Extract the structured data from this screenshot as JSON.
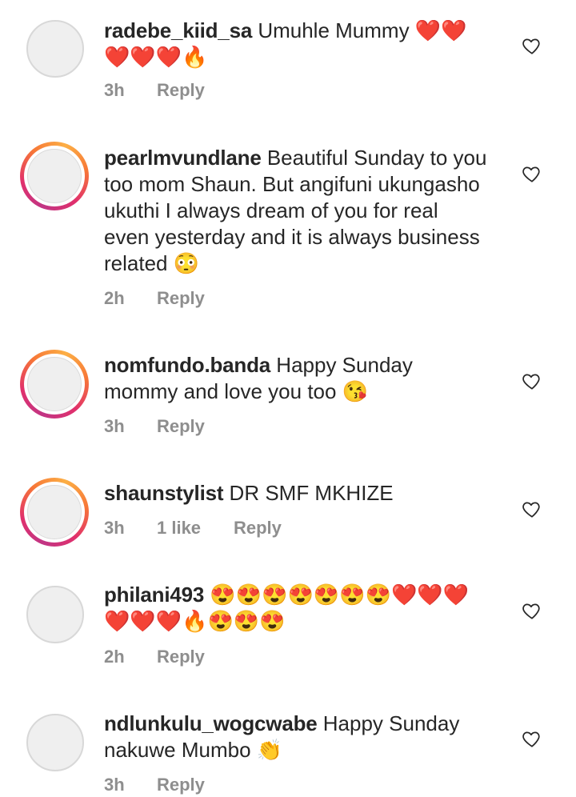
{
  "icons": {
    "like": "heart-outline-icon"
  },
  "colors": {
    "text": "#262626",
    "meta": "#8e8e8e",
    "story_ring": [
      "#c13584",
      "#e1306c",
      "#f77737",
      "#fcaf45"
    ]
  },
  "comments": [
    {
      "username": "radebe_kiid_sa",
      "text": "Umuhle Mummy ❤️❤️❤️❤️❤️🔥",
      "time": "3h",
      "likes": "",
      "reply": "Reply",
      "story_ring": false
    },
    {
      "username": "pearlmvundlane",
      "text": "Beautiful Sunday to you too mom Shaun. But angifuni ukungasho ukuthi I always dream of you for real even yesterday and it is always business related 😳",
      "time": "2h",
      "likes": "",
      "reply": "Reply",
      "story_ring": true
    },
    {
      "username": "nomfundo.banda",
      "text": "Happy Sunday mommy and love you too 😘",
      "time": "3h",
      "likes": "",
      "reply": "Reply",
      "story_ring": true
    },
    {
      "username": "shaunstylist",
      "text": "DR SMF MKHIZE",
      "time": "3h",
      "likes": "1 like",
      "reply": "Reply",
      "story_ring": true
    },
    {
      "username": "philani493",
      "text": "😍😍😍😍😍😍😍❤️❤️❤️❤️❤️❤️🔥😍😍😍",
      "time": "2h",
      "likes": "",
      "reply": "Reply",
      "story_ring": false
    },
    {
      "username": "ndlunkulu_wogcwabe",
      "text": "Happy Sunday nakuwe Mumbo 👏",
      "time": "3h",
      "likes": "",
      "reply": "Reply",
      "story_ring": false
    }
  ]
}
